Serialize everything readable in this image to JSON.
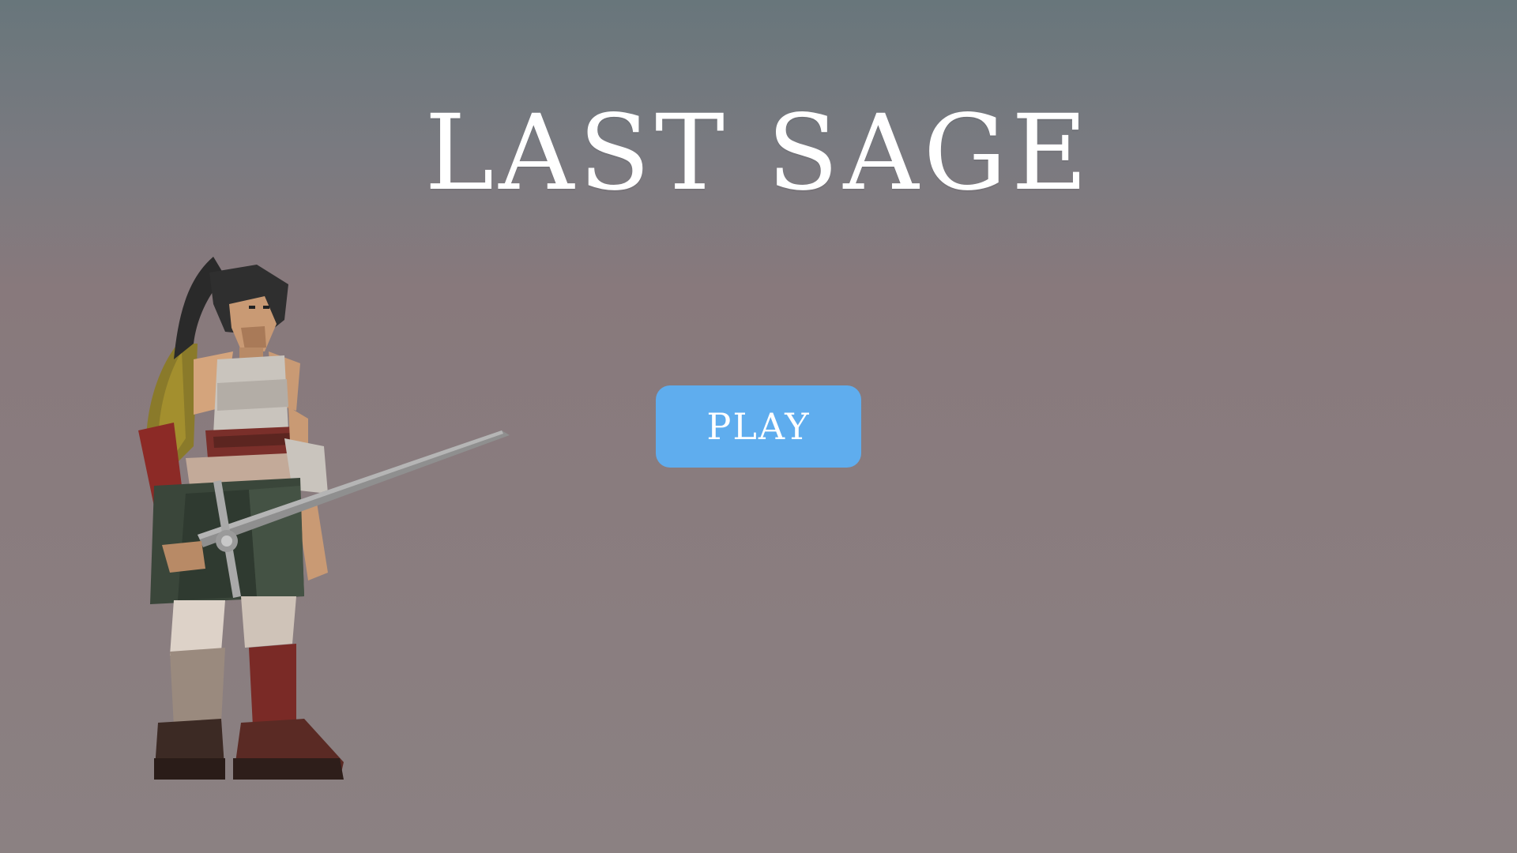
{
  "game": {
    "title": "LAST SAGE"
  },
  "menu": {
    "play_label": "PLAY"
  },
  "colors": {
    "play_button": "#5fadee",
    "title_text": "#ffffff"
  },
  "icons": {
    "hero": "warrior-with-sword-icon"
  }
}
